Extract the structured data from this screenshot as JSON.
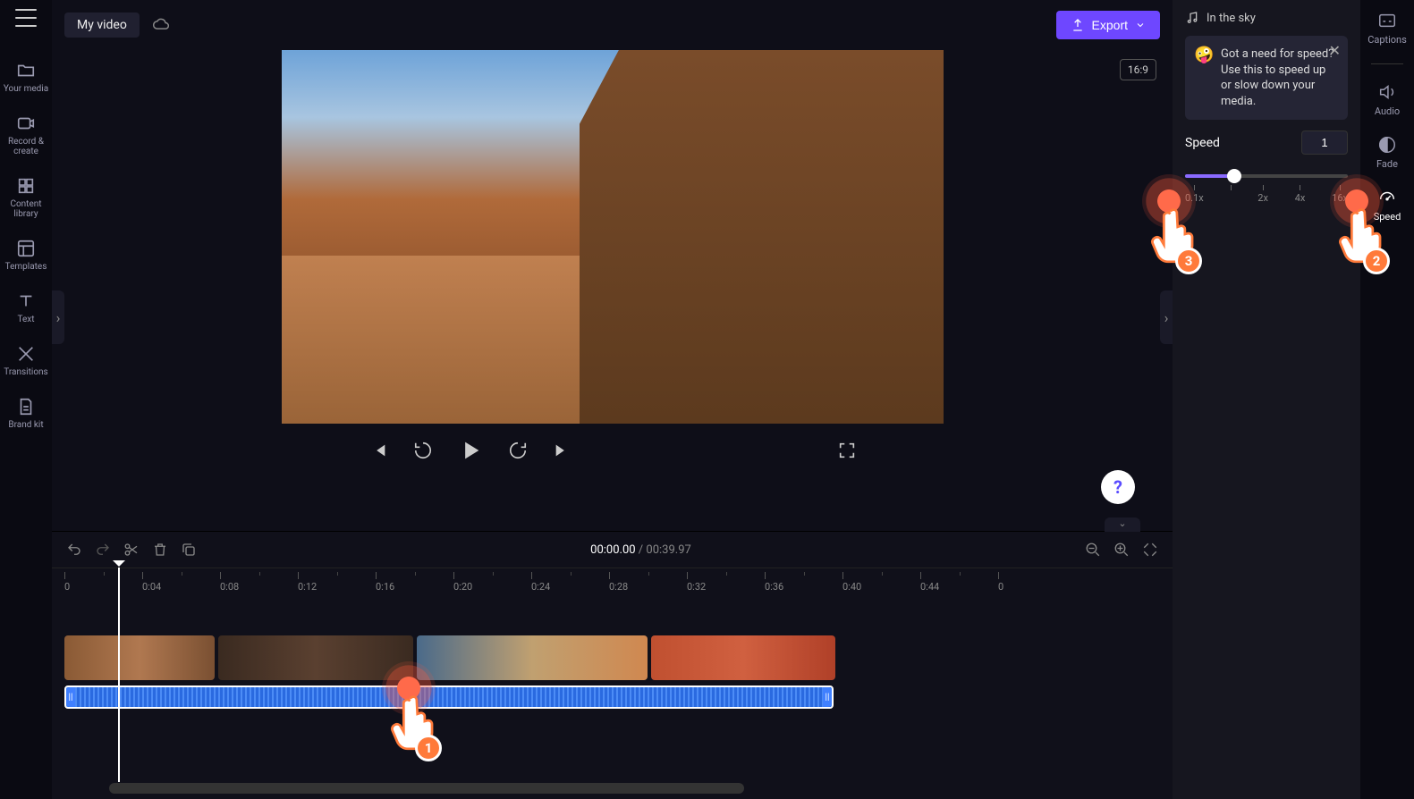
{
  "leftNav": {
    "items": [
      {
        "label": "Your media"
      },
      {
        "label": "Record & create"
      },
      {
        "label": "Content library"
      },
      {
        "label": "Templates"
      },
      {
        "label": "Text"
      },
      {
        "label": "Transitions"
      },
      {
        "label": "Brand kit"
      }
    ]
  },
  "header": {
    "title": "My video",
    "exportLabel": "Export",
    "aspectRatio": "16:9"
  },
  "player": {
    "currentTime": "00:00.00",
    "separator": " / ",
    "duration": "00:39.97"
  },
  "timeline": {
    "ticks": [
      "0",
      "0:04",
      "0:08",
      "0:12",
      "0:16",
      "0:20",
      "0:24",
      "0:28",
      "0:32",
      "0:36",
      "0:40",
      "0:44",
      "0"
    ]
  },
  "rightPanel": {
    "audioTrackName": "In the sky",
    "tooltip": "Got a need for speed? Use this to speed up or slow down your media.",
    "speedLabel": "Speed",
    "speedValue": "1",
    "speedStops": [
      "0.1x",
      "",
      "2x",
      "4x",
      "16x"
    ]
  },
  "rightRail": {
    "items": [
      {
        "label": "Captions"
      },
      {
        "label": "Audio"
      },
      {
        "label": "Fade"
      },
      {
        "label": "Speed"
      }
    ]
  },
  "markers": {
    "m1": "1",
    "m2": "2",
    "m3": "3"
  }
}
